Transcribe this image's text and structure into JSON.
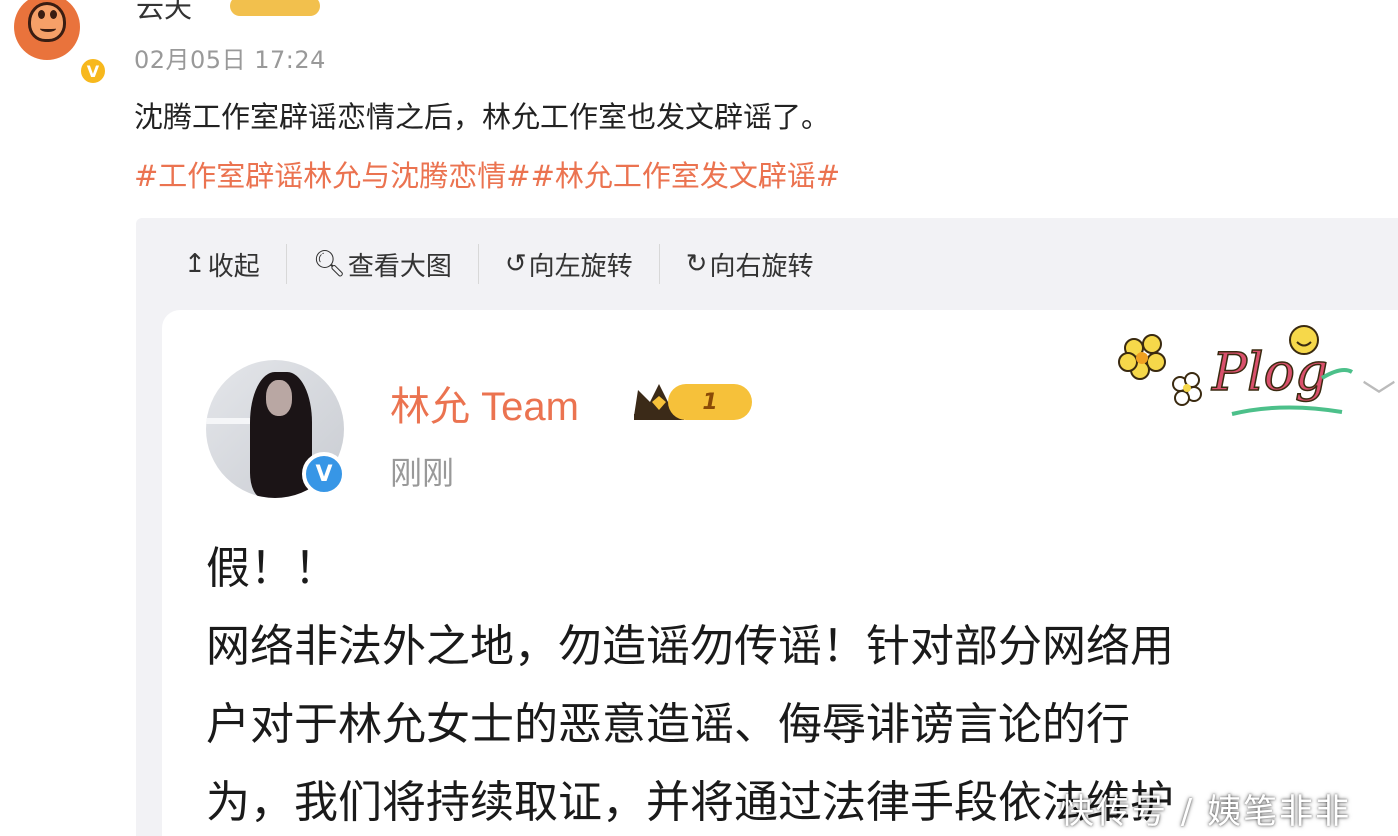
{
  "top_post": {
    "username": "云天",
    "time": "02月05日 17:24",
    "text": "沈腾工作室辟谣恋情之后，林允工作室也发文辟谣了。",
    "tags": "#工作室辟谣林允与沈腾恋情##林允工作室发文辟谣#"
  },
  "toolbar": {
    "collapse_label": "收起",
    "view_large_label": "查看大图",
    "rotate_left_label": "向左旋转",
    "rotate_right_label": "向右旋转"
  },
  "repost": {
    "username": "林允 Team",
    "level": "1",
    "time": "刚刚",
    "sticker_text": "Plog",
    "body_lines": [
      "假！！",
      "网络非法外之地，勿造谣勿传谣！针对部分网络用",
      "户对于林允女士的恶意造谣、侮辱诽谤言论的行",
      "为，我们将持续取证，并将通过法律手段依法维护"
    ]
  },
  "watermark": "快传号 / 姨笔非非",
  "colors": {
    "accent": "#eb7350",
    "verified_blue": "#3796e6",
    "verified_gold": "#f7b81d"
  },
  "icons": {
    "collapse": "arrow-up-icon",
    "view_large": "magnifier-icon",
    "rotate_left": "rotate-left-icon",
    "rotate_right": "rotate-right-icon"
  }
}
